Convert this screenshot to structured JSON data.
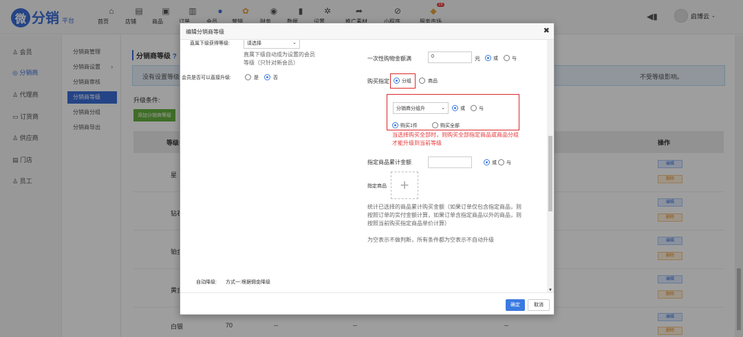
{
  "brand": {
    "mark": "微",
    "name": "分销",
    "sub": "平台"
  },
  "nav": [
    "首页",
    "店铺",
    "商品",
    "订单",
    "会员",
    "营销",
    "财务",
    "数据",
    "设置",
    "推广素材",
    "小程序",
    "服务市场"
  ],
  "nav_badge": "16",
  "user_name": "启博云",
  "sidebar": [
    "会员",
    "分销商",
    "代理商",
    "订货商",
    "供应商",
    "门店",
    "员工"
  ],
  "submenu": [
    "分销商管理",
    "分销商设置",
    "分销商审核",
    "分销商等级",
    "分销商分组",
    "分销商导出"
  ],
  "content": {
    "title": "分销商等级",
    "notice_left": "没有设置等级",
    "notice_right": "不受等级影响。",
    "cond_label": "升级条件:",
    "add_btn": "添加分销商等级",
    "th_level": "等级名",
    "th_ops": "操作",
    "rows": [
      {
        "name": "星"
      },
      {
        "name": "钻石"
      },
      {
        "name": "铂金"
      },
      {
        "name": "黄金"
      },
      {
        "name": "白银",
        "v1": "70",
        "v2": "--",
        "v3": "--",
        "v4": "--"
      }
    ],
    "edit_label": "编辑",
    "del_label": "删除"
  },
  "modal": {
    "title": "编辑分销商等级",
    "direct_label": "直属下级获得等级:",
    "direct_select": "请选择",
    "direct_help1": "直属下级自动成为设置的会员",
    "direct_help2": "等级（只针对新会员）",
    "member_upgrade_label": "会员是否可以直接升级:",
    "opt_yes": "是",
    "opt_no": "否",
    "once_label": "一次性购物金额满",
    "once_value": "0",
    "once_unit": "元",
    "opt_or": "或",
    "opt_and": "与",
    "buy_label": "购买指定",
    "opt_group": "分组",
    "opt_goods": "商品",
    "group_select": "分销商分组升",
    "buy_one": "购买1件",
    "buy_all": "购买全部",
    "warn1": "当选择购买全部时，则购买全部指定商品或商品分组",
    "warn2": "才能升级到当前等级",
    "amount_label": "指定商品累计金额",
    "goods_label": "指定商品",
    "help_stat1": "统计已选择的商品累计购买金额（如果订单仅包含指定商品，则",
    "help_stat2": "按照订单的实付金额计算，如果订单含指定商品以外的商品，则",
    "help_stat3": "按照当前购买指定商品单价计算）",
    "help_empty": "为空表示不做判断，所有条件都为空表示不自动升级",
    "auto_label": "自动降级:",
    "auto_value": "方式一:根据佣金降级",
    "ok": "确定",
    "cancel": "取消"
  }
}
